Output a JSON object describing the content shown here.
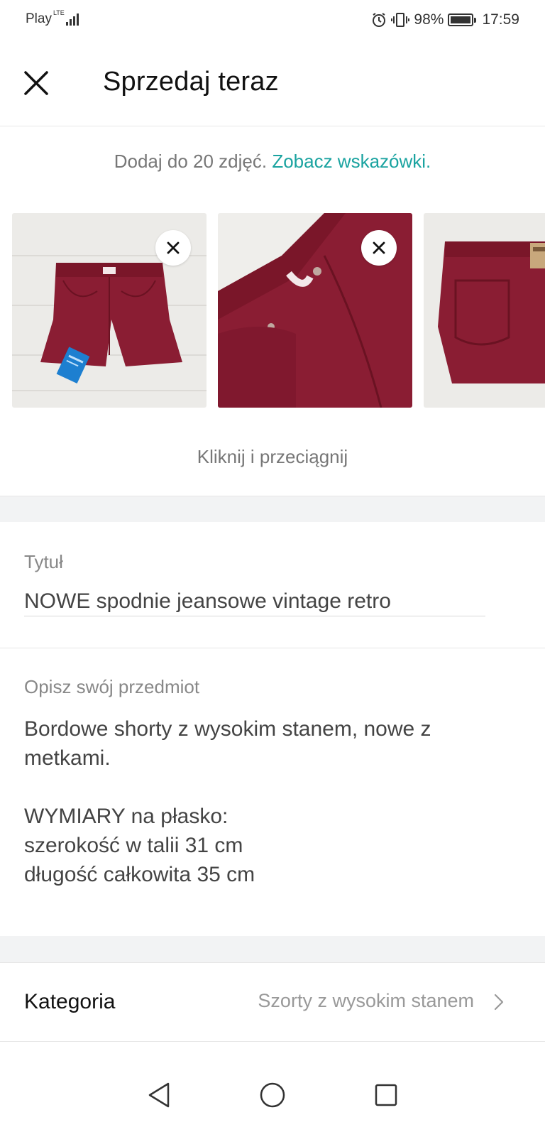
{
  "status_bar": {
    "carrier": "Play",
    "network": "LTE",
    "battery": "98%",
    "battery_level": 0.98,
    "time": "17:59"
  },
  "header": {
    "title": "Sprzedaj teraz",
    "close_icon": "close-icon"
  },
  "photos": {
    "hint_prefix": "Dodaj do 20 zdjęć. ",
    "hint_link": "Zobacz wskazówki.",
    "drag_hint": "Kliknij i przeciągnij",
    "items": [
      {
        "name": "photo-front",
        "remove_icon": "close-icon"
      },
      {
        "name": "photo-detail",
        "remove_icon": "close-icon"
      },
      {
        "name": "photo-back"
      }
    ]
  },
  "form": {
    "title_label": "Tytuł",
    "title_value": "NOWE spodnie jeansowe vintage retro",
    "description_label": "Opisz swój przedmiot",
    "description_value": "Bordowe shorty z wysokim stanem, nowe z\nmetkami.\n\nWYMIARY na płasko:\nszerokość w talii 31 cm\ndługość całkowita 35 cm",
    "category_label": "Kategoria",
    "category_value": "Szorty z wysokim stanem"
  },
  "colors": {
    "accent": "#1aa3a0",
    "denim": "#8a1d33",
    "band": "#f2f3f4"
  },
  "nav": {
    "back_icon": "back-triangle-icon",
    "home_icon": "home-circle-icon",
    "recents_icon": "recents-square-icon"
  }
}
